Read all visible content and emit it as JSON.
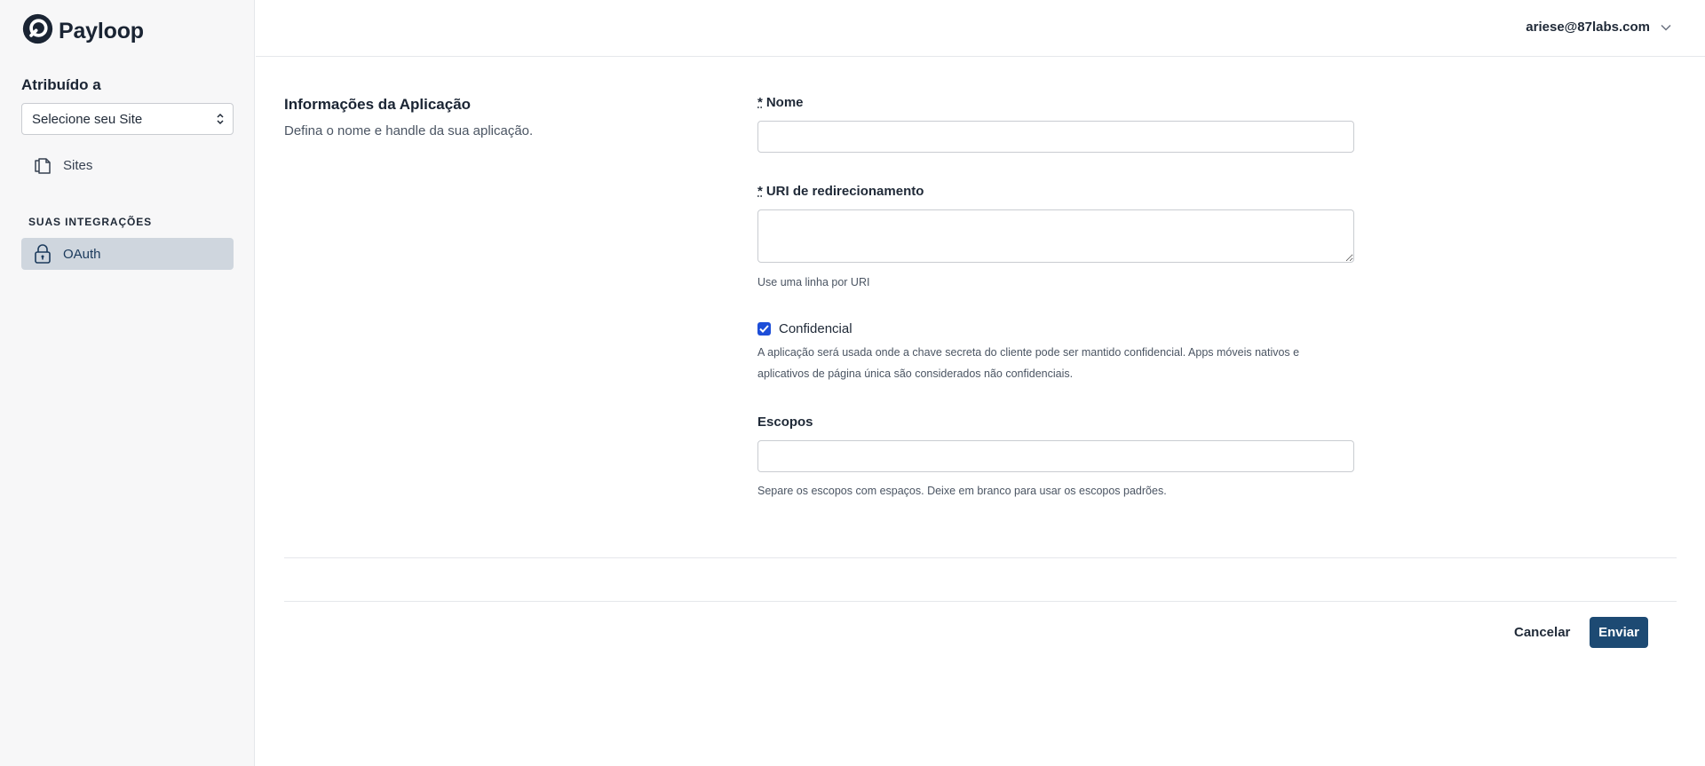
{
  "brand": {
    "name": "Payloop",
    "logo_icon": "payloop-logo-icon"
  },
  "sidebar": {
    "assigned_label": "Atribuído a",
    "site_select": {
      "selected": "Selecione seu Site"
    },
    "nav_sites": {
      "label": "Sites",
      "icon": "pages-icon"
    },
    "integrations_heading": "SUAS INTEGRAÇÕES",
    "nav_oauth": {
      "label": "OAuth",
      "icon": "lock-icon",
      "active": true
    }
  },
  "header": {
    "user_email": "ariese@87labs.com"
  },
  "form": {
    "section_title": "Informações da Aplicação",
    "section_description": "Defina o nome e handle da sua aplicação.",
    "required_marker": "*",
    "name": {
      "label": "Nome",
      "value": ""
    },
    "redirect_uri": {
      "label": "URI de redirecionamento",
      "value": "",
      "help": "Use uma linha por URI"
    },
    "confidential": {
      "label": "Confidencial",
      "checked": true,
      "help_line1": "A aplicação será usada onde a chave secreta do cliente pode ser mantido confidencial. Apps móveis nativos e",
      "help_line2": "aplicativos de página única são considerados não confidenciais."
    },
    "scopes": {
      "label": "Escopos",
      "value": "",
      "help": "Separe os escopos com espaços. Deixe em branco para usar os escopos padrões."
    }
  },
  "actions": {
    "cancel_label": "Cancelar",
    "submit_label": "Enviar"
  },
  "colors": {
    "primary": "#1d4a73",
    "active_nav_bg": "#cfd6de",
    "checkbox": "#1d4ed8"
  }
}
